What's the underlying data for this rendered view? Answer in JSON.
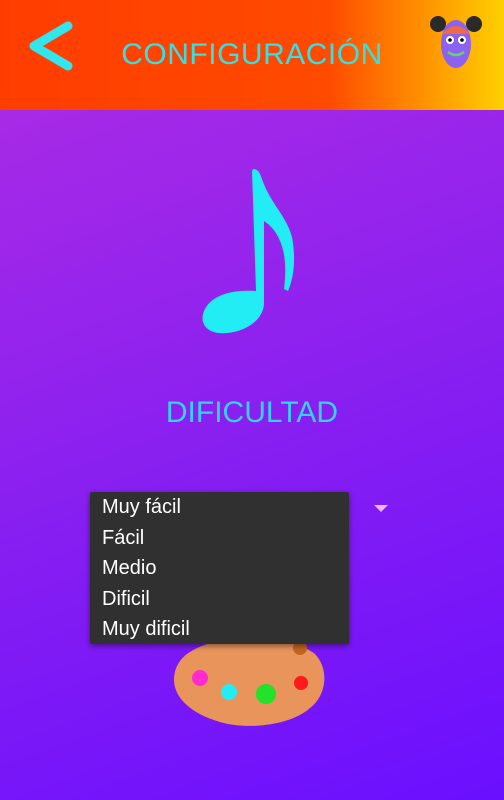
{
  "header": {
    "title": "CONFIGURACIÓN",
    "back_icon": "chevron-left-icon",
    "avatar_icon": "monster-avatar-icon",
    "colors": {
      "start": "#ff3d00",
      "end": "#ffd000",
      "accent": "#33e0e6"
    }
  },
  "main": {
    "music_icon": "music-note-icon",
    "difficulty_label": "DIFICULTAD",
    "palette_icon": "paint-palette-icon"
  },
  "difficulty_select": {
    "options": [
      "Muy fácil",
      "Fácil",
      "Medio",
      "Dificil",
      "Muy dificil"
    ]
  }
}
